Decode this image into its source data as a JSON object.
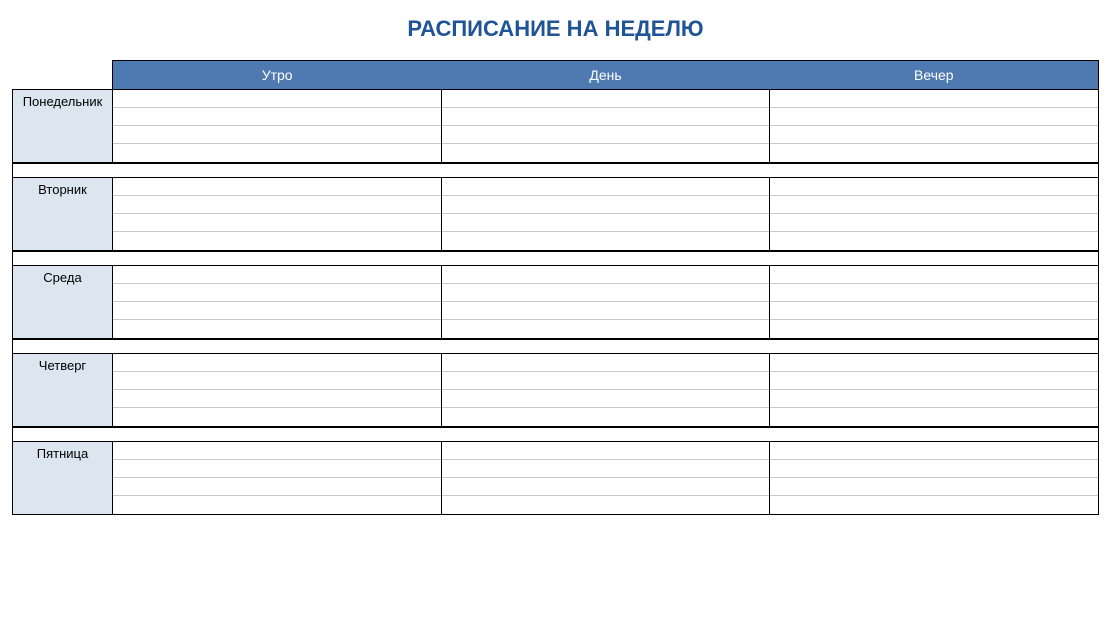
{
  "title": "РАСПИСАНИЕ НА НЕДЕЛЮ",
  "columns": [
    "Утро",
    "День",
    "Вечер"
  ],
  "days": [
    {
      "name": "Понедельник",
      "rows": [
        "",
        "",
        "",
        ""
      ]
    },
    {
      "name": "Вторник",
      "rows": [
        "",
        "",
        "",
        ""
      ]
    },
    {
      "name": "Среда",
      "rows": [
        "",
        "",
        "",
        ""
      ]
    },
    {
      "name": "Четверг",
      "rows": [
        "",
        "",
        "",
        ""
      ]
    },
    {
      "name": "Пятница",
      "rows": [
        "",
        "",
        "",
        ""
      ]
    }
  ]
}
